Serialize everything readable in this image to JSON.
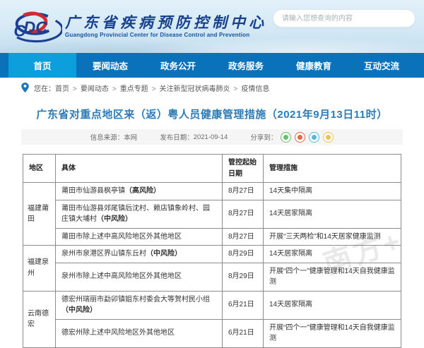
{
  "header": {
    "site_name_cn": "广东省疾病预防控制中心",
    "site_name_en": "Guangdong Provincial Center for Disease Control and Prevention",
    "search_placeholder": "请输入您想查询的内容"
  },
  "nav": {
    "items": [
      {
        "label": "首页",
        "active": true
      },
      {
        "label": "要闻动态",
        "active": false
      },
      {
        "label": "政务公开",
        "active": false
      },
      {
        "label": "政务服务",
        "active": false
      },
      {
        "label": "健康教育",
        "active": false
      },
      {
        "label": "互动交流",
        "active": false
      }
    ]
  },
  "breadcrumb": {
    "prefix": "您在：",
    "separator": ">",
    "items": [
      "首页",
      "要闻动态",
      "重点专题",
      "关注新型冠状病毒肺炎",
      "疫情信息"
    ]
  },
  "article": {
    "title": "广东省对重点地区来（返）粤人员健康管理措施（2021年9月13日11时）",
    "source_label": "信息来源：",
    "source_value": "本网",
    "date_label": "发布日期：",
    "date_value": "2021-09-14",
    "share_label": "分享到：",
    "share_icons": [
      {
        "name": "wechat-icon",
        "color": "#6abf69"
      },
      {
        "name": "weibo-icon",
        "color": "#e2674a"
      },
      {
        "name": "qq-icon",
        "color": "#55b7e0"
      },
      {
        "name": "qzone-icon",
        "color": "#edc34f"
      }
    ]
  },
  "table": {
    "headers": [
      "地区",
      "具体",
      "管控起始日期",
      "管理措施"
    ],
    "groups": [
      {
        "region": "福建莆田",
        "rows": [
          {
            "place": "莆田市仙游县枫亭镇",
            "risk": "（高风险）",
            "date": "8月27日",
            "measure": "14天集中隔离"
          },
          {
            "place": "莆田市仙游县郊尾镇后沈村、赖店镇象岭村、园庄镇大埔村",
            "risk": "（中风险）",
            "date": "8月27日",
            "measure": "14天居家隔离"
          },
          {
            "place": "莆田市除上述中高风险地区外其他地区",
            "risk": "",
            "date": "8月27日",
            "measure": "开展“三天两检”和14天居家健康监测"
          }
        ]
      },
      {
        "region": "福建泉州",
        "rows": [
          {
            "place": "泉州市泉港区界山镇东丘村",
            "risk": "（中风险）",
            "date": "8月29日",
            "measure": "14天居家隔离"
          },
          {
            "place": "泉州市除上述中高风险地区外其他地区",
            "risk": "",
            "date": "8月29日",
            "measure": "开展“四个一”健康管理和14天自我健康监测"
          }
        ]
      },
      {
        "region": "云南德宏",
        "rows": [
          {
            "place": "德宏州瑞丽市勐卯镇姐东村委会大等贺村民小组",
            "risk": "（中风险）",
            "date": "6月21日",
            "measure": "14天居家隔离"
          },
          {
            "place": "德宏州除上述中风险地区外其他地区",
            "risk": "",
            "date": "6月21日",
            "measure": "开展“四个一”健康管理和14天自我健康监测"
          }
        ]
      }
    ]
  },
  "watermark": "南方+",
  "colors": {
    "nav_blue": "#0a72ba",
    "nav_active_blue": "#0d9fdc",
    "title_blue": "#2d7cb5",
    "logo_blue": "#1c3f94",
    "logo_red": "#d6282d"
  }
}
